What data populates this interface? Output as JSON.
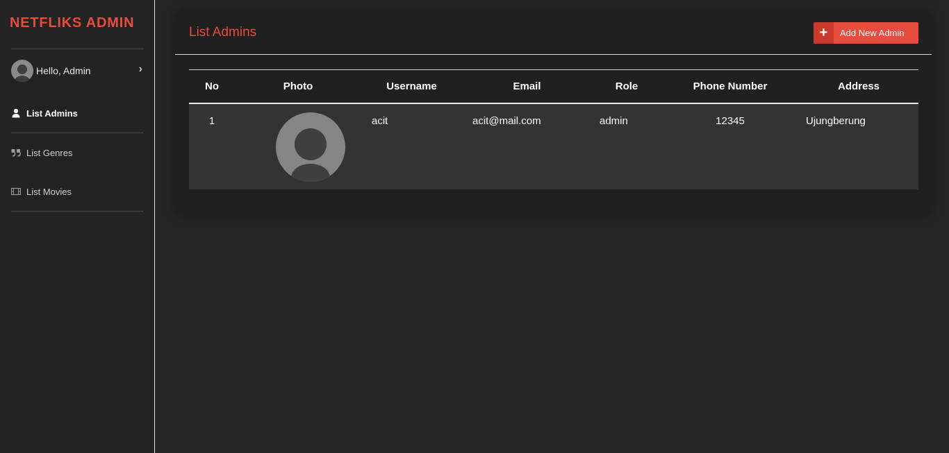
{
  "brand": "NETFLIKS ADMIN",
  "user": {
    "greeting": "Hello, Admin"
  },
  "nav": [
    {
      "label": "List Admins",
      "icon": "user-icon",
      "active": true
    },
    {
      "label": "List Genres",
      "icon": "quote-icon",
      "active": false
    },
    {
      "label": "List Movies",
      "icon": "film-icon",
      "active": false
    }
  ],
  "main": {
    "title": "List Admins",
    "add_button": "Add New Admin",
    "table": {
      "columns": [
        "No",
        "Photo",
        "Username",
        "Email",
        "Role",
        "Phone Number",
        "Address"
      ],
      "rows": [
        {
          "no": "1",
          "photo": "avatar-placeholder",
          "username": "acit",
          "email": "acit@mail.com",
          "role": "admin",
          "phone": "12345",
          "address": "Ujungberung"
        }
      ]
    }
  },
  "colors": {
    "accent": "#e74c3c",
    "background": "#262626",
    "sidebar": "#232323",
    "card": "#202020",
    "row": "#333333"
  }
}
